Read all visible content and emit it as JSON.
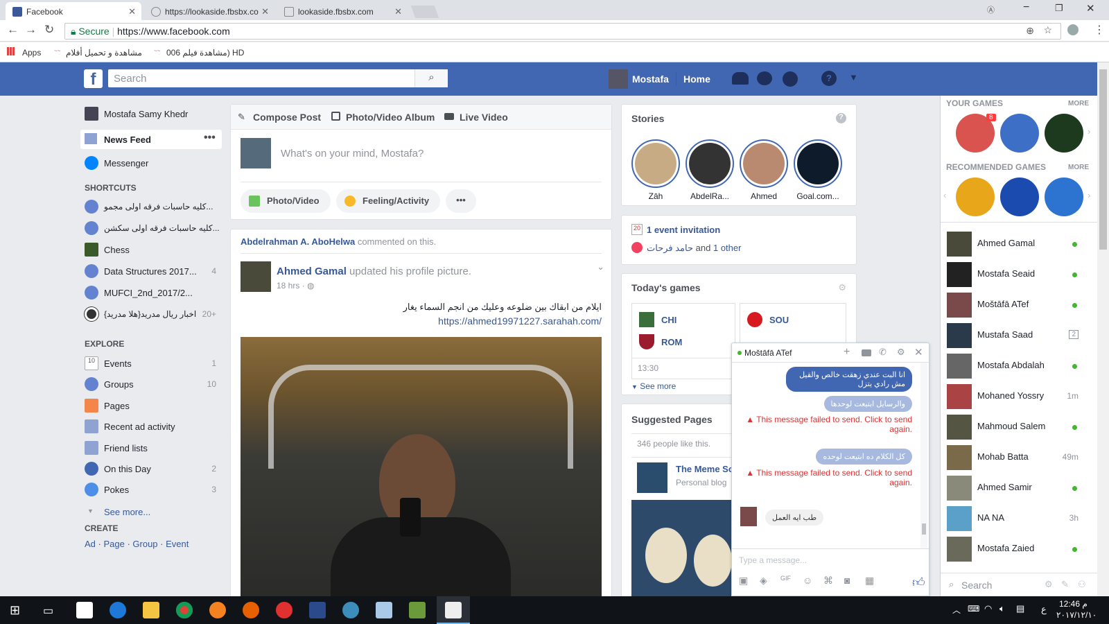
{
  "browser": {
    "tabs": [
      {
        "label": "Facebook"
      },
      {
        "label": "https://lookaside.fbsbx.co"
      },
      {
        "label": "lookaside.fbsbx.com"
      }
    ],
    "secure_label": "Secure",
    "url": "https://www.facebook.com",
    "bookmarks": {
      "apps": "Apps",
      "b1": "مشاهدة و تحميل أفلام",
      "b2": "مشاهدة فيلم 006) HD"
    },
    "window_controls_label": "Ⓐ"
  },
  "fb": {
    "search_placeholder": "Search",
    "profile_name": "Mostafa",
    "home": "Home"
  },
  "left_nav": {
    "user": "Mostafa Samy Khedr",
    "news_feed": "News Feed",
    "messenger": "Messenger",
    "shortcuts_title": "SHORTCUTS",
    "shortcuts": [
      {
        "label": "كليه حاسبات فرقه اولى مجمو...",
        "count": ""
      },
      {
        "label": "كليه حاسبات فرقه اولى سكشن...",
        "count": ""
      },
      {
        "label": "Chess",
        "count": ""
      },
      {
        "label": "Data Structures 2017...",
        "count": "4"
      },
      {
        "label": "MUFCI_2nd_2017/2...",
        "count": ""
      },
      {
        "label": "اخبار ريال مدريد{هلا مدريد}",
        "count": "20+"
      }
    ],
    "explore_title": "EXPLORE",
    "explore": [
      {
        "label": "Events",
        "count": "1"
      },
      {
        "label": "Groups",
        "count": "10"
      },
      {
        "label": "Pages",
        "count": ""
      },
      {
        "label": "Recent ad activity",
        "count": ""
      },
      {
        "label": "Friend lists",
        "count": ""
      },
      {
        "label": "On this Day",
        "count": "2"
      },
      {
        "label": "Pokes",
        "count": "3"
      }
    ],
    "see_more": "See more...",
    "create_title": "CREATE",
    "create_links": {
      "ad": "Ad",
      "page": "Page",
      "group": "Group",
      "event": "Event"
    }
  },
  "composer": {
    "tab_compose": "Compose Post",
    "tab_album": "Photo/Video Album",
    "tab_live": "Live Video",
    "placeholder": "What's on your mind, Mostafa?",
    "photo_video": "Photo/Video",
    "feeling": "Feeling/Activity"
  },
  "post": {
    "context_name": "Abdelrahman A. AboHelwa",
    "context_action": "commented on this.",
    "author": "Ahmed Gamal",
    "action": "updated his profile picture.",
    "time": "18 hrs",
    "text_ar": "ايلام من ابقاك بين ضلوعه وعليك من انجم السماء يغار",
    "link": "https://ahmed19971227.sarahah.com/"
  },
  "stories": {
    "title": "Stories",
    "items": [
      {
        "name": "Zāh"
      },
      {
        "name": "AbdelRa..."
      },
      {
        "name": "Ahmed"
      },
      {
        "name": "Goal.com..."
      }
    ]
  },
  "events": {
    "invitation": "1 event invitation",
    "from_name": "حامد فرحات",
    "and": "and",
    "other": "1 other"
  },
  "games": {
    "title": "Today's games",
    "teams": [
      "CHI",
      "ROM",
      "SOU"
    ],
    "time": "13:30",
    "see_more": "See more"
  },
  "suggested": {
    "title": "Suggested Pages",
    "likes": "346 people like this.",
    "page_name": "The Meme Sc",
    "page_type": "Personal blog"
  },
  "chat": {
    "name": "Moštāfā ATef",
    "messages": [
      {
        "text": "انا البت عندي زهقت خالص والقيل مش رادي يتزل"
      },
      {
        "text": "والرسايل ابتيعت لوحدها"
      },
      {
        "text": "كل الكلام ده ابتيعت لوحده"
      },
      {
        "text": "طب ايه العمل"
      }
    ],
    "fail_text": "This message failed to send. Click to send again.",
    "input_placeholder": "Type a message..."
  },
  "right_sidebar": {
    "your_games": "YOUR GAMES",
    "more": "MORE",
    "badge": "8",
    "recommended": "RECOMMENDED GAMES",
    "contacts": [
      {
        "name": "Ahmed Gamal",
        "status": "online"
      },
      {
        "name": "Mostafa Seaid",
        "status": "online"
      },
      {
        "name": "Moštāfā ATef",
        "status": "online"
      },
      {
        "name": "Mustafa Saad",
        "status": "2"
      },
      {
        "name": "Mostafa Abdalah",
        "status": "online"
      },
      {
        "name": "Mohaned Yossry",
        "status": "1m"
      },
      {
        "name": "Mahmoud Salem",
        "status": "online"
      },
      {
        "name": "Mohab Batta",
        "status": "49m"
      },
      {
        "name": "Ahmed Samir",
        "status": "online"
      },
      {
        "name": "NA NA",
        "status": "3h"
      },
      {
        "name": "Mostafa Zaied",
        "status": "online"
      }
    ],
    "search": "Search"
  },
  "taskbar": {
    "time": "12:46 م",
    "date": "٢٠١٧/١٢/١٠",
    "lang": "ع"
  }
}
